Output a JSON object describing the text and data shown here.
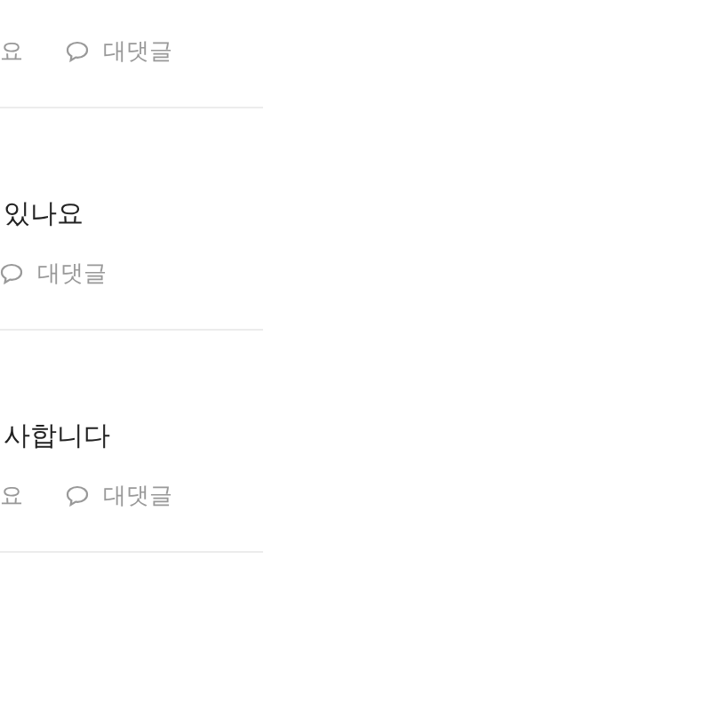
{
  "comments": [
    {
      "like_label": "요",
      "reply_label": "대댓글"
    },
    {
      "text": "있나요",
      "reply_label": "대댓글"
    },
    {
      "text": "사합니다",
      "like_label": "요",
      "reply_label": "대댓글"
    }
  ]
}
